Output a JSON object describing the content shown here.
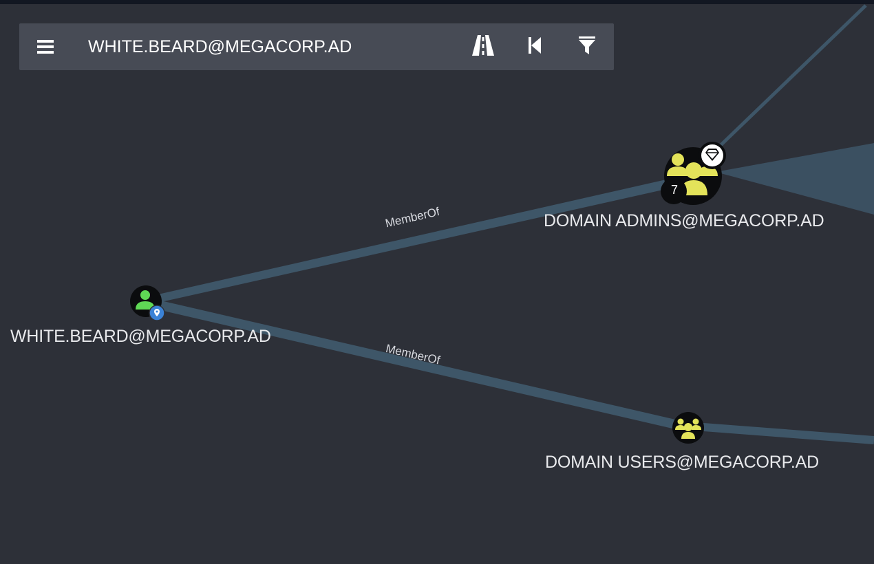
{
  "search": {
    "value": "WHITE.BEARD@MEGACORP.AD"
  },
  "toolbar": {
    "menu_icon": "hamburger-menu-icon",
    "pathfinding_icon": "road-icon",
    "back_icon": "step-backward-icon",
    "filter_icon": "filter-icon"
  },
  "nodes": {
    "user": {
      "label": "WHITE.BEARD@MEGACORP.AD",
      "type": "user",
      "icon": "user-icon",
      "badge_icon": "map-marker-icon"
    },
    "domain_admins": {
      "label": "DOMAIN ADMINS@MEGACORP.AD",
      "type": "group",
      "icon": "group-icon",
      "badge_icon": "diamond-icon",
      "count": "7"
    },
    "domain_users": {
      "label": "DOMAIN USERS@MEGACORP.AD",
      "type": "group",
      "icon": "group-icon"
    }
  },
  "edges": [
    {
      "label": "MemberOf"
    },
    {
      "label": "MemberOf"
    }
  ],
  "colors": {
    "background": "#2d3038",
    "search_bar": "#474b55",
    "edge": "#3e5668",
    "user_icon": "#5fd855",
    "group_icon": "#e3e35a",
    "badge_blue": "#3b82d6"
  }
}
